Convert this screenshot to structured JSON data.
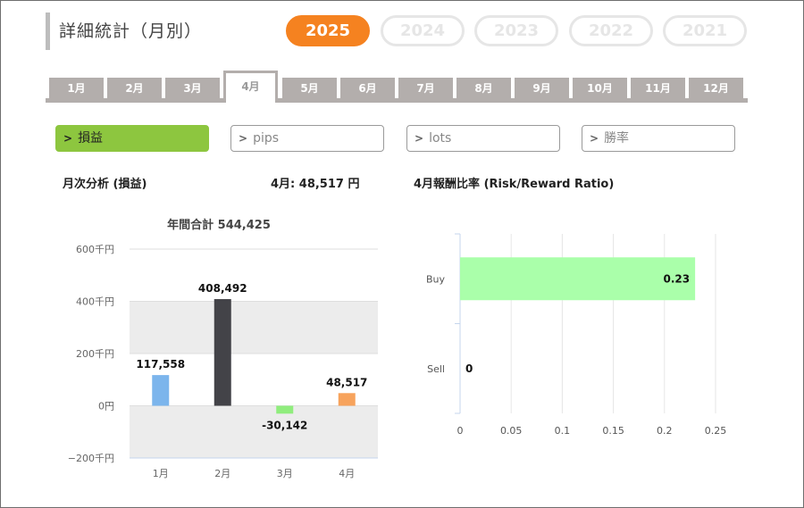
{
  "header": {
    "title": "詳細統計（月別）"
  },
  "years": [
    {
      "label": "2025",
      "active": true
    },
    {
      "label": "2024",
      "active": false
    },
    {
      "label": "2023",
      "active": false
    },
    {
      "label": "2022",
      "active": false
    },
    {
      "label": "2021",
      "active": false
    }
  ],
  "months": [
    {
      "label": "1月",
      "active": false
    },
    {
      "label": "2月",
      "active": false
    },
    {
      "label": "3月",
      "active": false
    },
    {
      "label": "4月",
      "active": true
    },
    {
      "label": "5月",
      "active": false
    },
    {
      "label": "6月",
      "active": false
    },
    {
      "label": "7月",
      "active": false
    },
    {
      "label": "8月",
      "active": false
    },
    {
      "label": "9月",
      "active": false
    },
    {
      "label": "10月",
      "active": false
    },
    {
      "label": "11月",
      "active": false
    },
    {
      "label": "12月",
      "active": false
    }
  ],
  "metrics": [
    {
      "label": "損益",
      "active": true
    },
    {
      "label": "pips",
      "active": false
    },
    {
      "label": "lots",
      "active": false
    },
    {
      "label": "勝率",
      "active": false
    }
  ],
  "analysis": {
    "heading": "月次分析 (損益)",
    "month_total": "4月:  48,517 円",
    "ratio_heading": "4月報酬比率 (Risk/Reward Ratio)"
  },
  "colors": {
    "accent_orange": "#f58220",
    "active_green": "#8dc63f",
    "tab_gray": "#b3aeac"
  },
  "chart_data": [
    {
      "type": "bar",
      "title": "年間合計 544,425",
      "categories": [
        "1月",
        "2月",
        "3月",
        "4月"
      ],
      "values": [
        117558,
        408492,
        -30142,
        48517
      ],
      "value_labels": [
        "117,558",
        "408,492",
        "-30,142",
        "48,517"
      ],
      "colors": [
        "#7cb5ec",
        "#434348",
        "#90ed7d",
        "#f7a35c"
      ],
      "ylim": [
        -200000,
        600000
      ],
      "yticks": [
        600000,
        400000,
        200000,
        0,
        -200000
      ],
      "ytick_labels": [
        "600千円",
        "400千円",
        "200千円",
        "0円",
        "−200千円"
      ],
      "grid": "alternating bands"
    },
    {
      "type": "bar",
      "orientation": "horizontal",
      "title": "4月報酬比率 (Risk/Reward Ratio)",
      "categories": [
        "Buy",
        "Sell"
      ],
      "values": [
        0.23,
        0
      ],
      "value_labels": [
        "0.23",
        "0"
      ],
      "color": "#aaffaa",
      "xlim": [
        0,
        0.25
      ],
      "xticks": [
        0,
        0.05,
        0.1,
        0.15,
        0.2,
        0.25
      ],
      "xtick_labels": [
        "0",
        "0.05",
        "0.1",
        "0.15",
        "0.2",
        "0.25"
      ],
      "grid": "vertical"
    }
  ]
}
